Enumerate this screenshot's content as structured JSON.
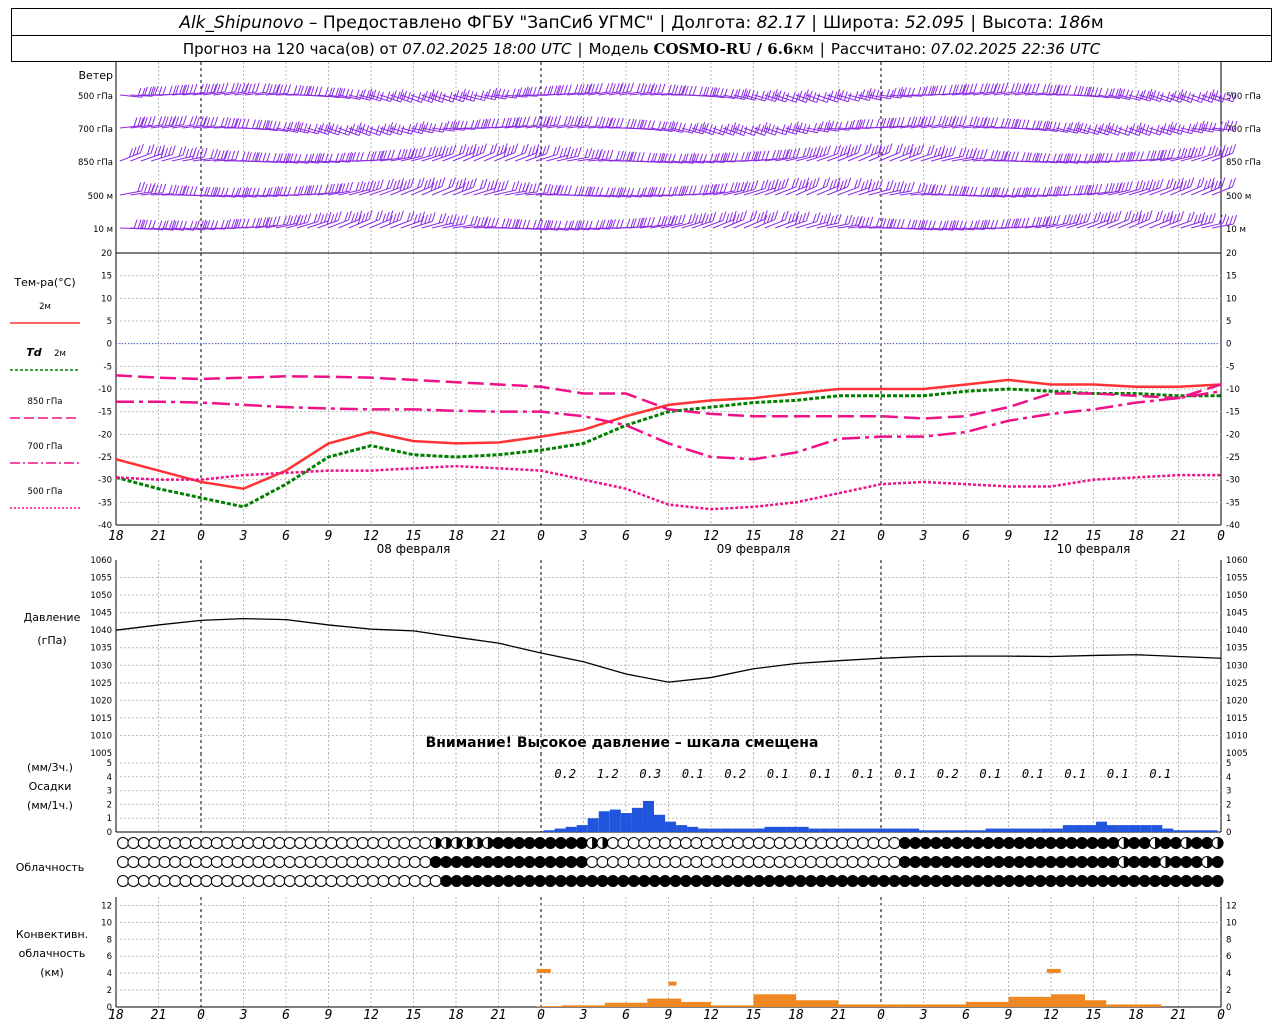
{
  "header": {
    "station": "Alk_Shipunovo",
    "provider": "– Предоставлено ФГБУ \"ЗапСиб УГМС\"",
    "lon_label": "Долгота:",
    "lon": "82.17",
    "lat_label": "Широта:",
    "lat": "52.095",
    "alt_label": "Высота:",
    "alt": "186",
    "alt_unit": "м",
    "forecast_prefix": "Прогноз на 120 часа(ов) от",
    "forecast_from": "07.02.2025 18:00 UTC",
    "model_label": "Модель",
    "model": "COSMO-RU / 6.6",
    "model_unit": "км",
    "calc_label": "Рассчитано:",
    "calc_time": "07.02.2025 22:36 UTC"
  },
  "colors": {
    "wind": "#8a2be2",
    "t2m": "#ff3333",
    "td2m": "#008000",
    "t850": "#ee1188",
    "t700": "#ee1188",
    "t500": "#ee1188",
    "zero_line": "#3355ff",
    "pressure": "#000000",
    "precip": "#2255dd",
    "convective": "#ee8822",
    "grid": "#bbbbbb"
  },
  "chart_data": {
    "type": "meteogram",
    "x_hours": [
      "18",
      "21",
      "0",
      "3",
      "6",
      "9",
      "12",
      "15",
      "18",
      "21",
      "0",
      "3",
      "6",
      "9",
      "12",
      "15",
      "18",
      "21",
      "0",
      "3",
      "6",
      "9",
      "12",
      "15",
      "18",
      "21",
      "0"
    ],
    "day_labels": [
      "08 февраля",
      "09 февраля",
      "10 февраля"
    ],
    "wind": {
      "title": "Ветер",
      "levels": [
        "500 гПа",
        "700 гПа",
        "850 гПа",
        "500 м",
        "10 м"
      ]
    },
    "temperature": {
      "title": "Тем-ра(°C)",
      "ylim": [
        -40,
        20
      ],
      "yticks": [
        "20",
        "15",
        "10",
        "5",
        "0",
        "-5",
        "-10",
        "-15",
        "-20",
        "-25",
        "-30",
        "-35",
        "-40"
      ],
      "legend": {
        "t2m": "2м",
        "td_sym": "Td",
        "td": "2м",
        "t850": "850 гПа",
        "t700": "700 гПа",
        "t500": "500 гПа"
      },
      "series": [
        {
          "name": "2м",
          "x": [
            0,
            1,
            2,
            3,
            4,
            5,
            6,
            7,
            8,
            9,
            10,
            11,
            12,
            13,
            14,
            15,
            16,
            17,
            18,
            19,
            20,
            21,
            22,
            23,
            24,
            25,
            26
          ],
          "values": [
            -25.5,
            -28,
            -30.5,
            -32,
            -28,
            -22,
            -19.5,
            -21.5,
            -22,
            -21.8,
            -20.5,
            -19,
            -16,
            -13.5,
            -12.5,
            -12,
            -11,
            -10,
            -10,
            -10,
            -9,
            -8,
            -9,
            -9,
            -9.5,
            -9.5,
            -9
          ]
        },
        {
          "name": "Td 2м",
          "x": [
            0,
            1,
            2,
            3,
            4,
            5,
            6,
            7,
            8,
            9,
            10,
            11,
            12,
            13,
            14,
            15,
            16,
            17,
            18,
            19,
            20,
            21,
            22,
            23,
            24,
            25,
            26
          ],
          "values": [
            -29.5,
            -32,
            -34,
            -36,
            -31,
            -25,
            -22.5,
            -24.5,
            -25,
            -24.5,
            -23.5,
            -22,
            -18,
            -15,
            -14,
            -13,
            -12.5,
            -11.5,
            -11.5,
            -11.5,
            -10.5,
            -10,
            -10.5,
            -11,
            -11,
            -11.5,
            -11.5
          ]
        },
        {
          "name": "850 гПа",
          "x": [
            0,
            1,
            2,
            3,
            4,
            5,
            6,
            7,
            8,
            9,
            10,
            11,
            12,
            13,
            14,
            15,
            16,
            17,
            18,
            19,
            20,
            21,
            22,
            23,
            24,
            25,
            26
          ],
          "values": [
            -7,
            -7.5,
            -7.8,
            -7.5,
            -7.2,
            -7.3,
            -7.5,
            -8,
            -8.5,
            -9,
            -9.5,
            -11,
            -11,
            -14.5,
            -15.5,
            -16,
            -16,
            -16,
            -16,
            -16.5,
            -16,
            -14,
            -11,
            -11,
            -11.5,
            -12,
            -9
          ]
        },
        {
          "name": "700 гПа",
          "x": [
            0,
            1,
            2,
            3,
            4,
            5,
            6,
            7,
            8,
            9,
            10,
            11,
            12,
            13,
            14,
            15,
            16,
            17,
            18,
            19,
            20,
            21,
            22,
            23,
            24,
            25,
            26
          ],
          "values": [
            -12.8,
            -12.8,
            -13,
            -13.5,
            -14,
            -14.3,
            -14.5,
            -14.5,
            -14.8,
            -15,
            -15,
            -16,
            -18,
            -22,
            -25,
            -25.5,
            -24,
            -21,
            -20.5,
            -20.5,
            -19.5,
            -17,
            -15.5,
            -14.5,
            -13,
            -12,
            -10.5
          ]
        },
        {
          "name": "500 гПа",
          "x": [
            0,
            1,
            2,
            3,
            4,
            5,
            6,
            7,
            8,
            9,
            10,
            11,
            12,
            13,
            14,
            15,
            16,
            17,
            18,
            19,
            20,
            21,
            22,
            23,
            24,
            25,
            26
          ],
          "values": [
            -29.5,
            -30,
            -30,
            -29,
            -28.5,
            -28,
            -28,
            -27.5,
            -27,
            -27.5,
            -28,
            -30,
            -32,
            -35.5,
            -36.5,
            -36,
            -35,
            -33,
            -31,
            -30.5,
            -31,
            -31.5,
            -31.5,
            -30,
            -29.5,
            -29,
            -29
          ]
        }
      ]
    },
    "pressure": {
      "title": "Давление",
      "unit": "(гПа)",
      "ylim": [
        1005,
        1060
      ],
      "yticks": [
        "1060",
        "1055",
        "1050",
        "1045",
        "1040",
        "1035",
        "1030",
        "1025",
        "1020",
        "1015",
        "1010",
        "1005"
      ],
      "note": "Внимание! Высокое давление – шкала смещена",
      "x": [
        0,
        1,
        2,
        3,
        4,
        5,
        6,
        7,
        8,
        9,
        10,
        11,
        12,
        13,
        14,
        15,
        16,
        17,
        18,
        19,
        20,
        21,
        22,
        23,
        24,
        25,
        26
      ],
      "values": [
        1040,
        1041.5,
        1042.8,
        1043.3,
        1043,
        1041.5,
        1040.3,
        1039.8,
        1038,
        1036.3,
        1033.5,
        1031,
        1027.5,
        1025.2,
        1026.5,
        1029,
        1030.5,
        1031.3,
        1032,
        1032.5,
        1032.6,
        1032.6,
        1032.5,
        1032.8,
        1033,
        1032.5,
        1032
      ]
    },
    "precip": {
      "title1": "(мм/3ч.)",
      "title2": "Осадки",
      "title3": "(мм/1ч.)",
      "yticks": [
        "5",
        "4",
        "3",
        "2",
        "1",
        "0"
      ],
      "totals": [
        "0.2",
        "1.2",
        "0.3",
        "0.1",
        "0.2",
        "0.1",
        "0.1",
        "0.1",
        "0.1",
        "0.2",
        "0.1",
        "0.1",
        "0.1",
        "0.1",
        "0.1"
      ],
      "total_slots": [
        11,
        12,
        13,
        14,
        15,
        16,
        17,
        18,
        19,
        20,
        21,
        22,
        23,
        24,
        25
      ],
      "hourly_start": 11,
      "hourly_values": [
        0.05,
        0.1,
        0.15,
        0.2,
        0.4,
        0.6,
        0.65,
        0.55,
        0.7,
        0.9,
        0.5,
        0.3,
        0.2,
        0.15,
        0.1,
        0.1,
        0.1,
        0.1,
        0.1,
        0.1,
        0.15,
        0.15,
        0.15,
        0.15,
        0.1,
        0.1,
        0.1,
        0.1,
        0.1,
        0.1,
        0.1,
        0.1,
        0.1,
        0.1,
        0.05,
        0.05,
        0.05,
        0.05,
        0.05,
        0.05,
        0.1,
        0.1,
        0.1,
        0.1,
        0.1,
        0.1,
        0.1,
        0.2,
        0.2,
        0.2,
        0.3,
        0.2,
        0.2,
        0.2,
        0.2,
        0.2,
        0.1,
        0.05,
        0.05,
        0.05,
        0.05,
        0.05,
        0.05,
        0.05,
        0.05,
        0.05,
        0.05,
        0.05,
        0.05,
        0.05,
        0.05,
        0.05,
        0.05,
        0.05,
        0.05,
        0.1,
        0.1,
        0.1,
        0.2,
        0.15,
        0.05
      ]
    },
    "cloud": {
      "title": "Облачность",
      "rows": [
        "upper",
        "middle",
        "lower"
      ],
      "upper": "0000000000000000000000000000000000000000000000000000000000000000000000000000000000000000000000000000000000000",
      "middle": "0000000000000000000000000000000000000000000000000000000000000000000000000000000000000000000000000000000000000",
      "lower": "0000000000000000000000000000000000000000000000000000000000000000000000000000000000000000000000000000000000000"
    },
    "convective": {
      "title1": "Конвективн.",
      "title2": "облачность",
      "title3": "(км)",
      "ylim": [
        0,
        13
      ],
      "yticks": [
        "12",
        "10",
        "8",
        "6",
        "4",
        "2",
        "0"
      ]
    }
  }
}
